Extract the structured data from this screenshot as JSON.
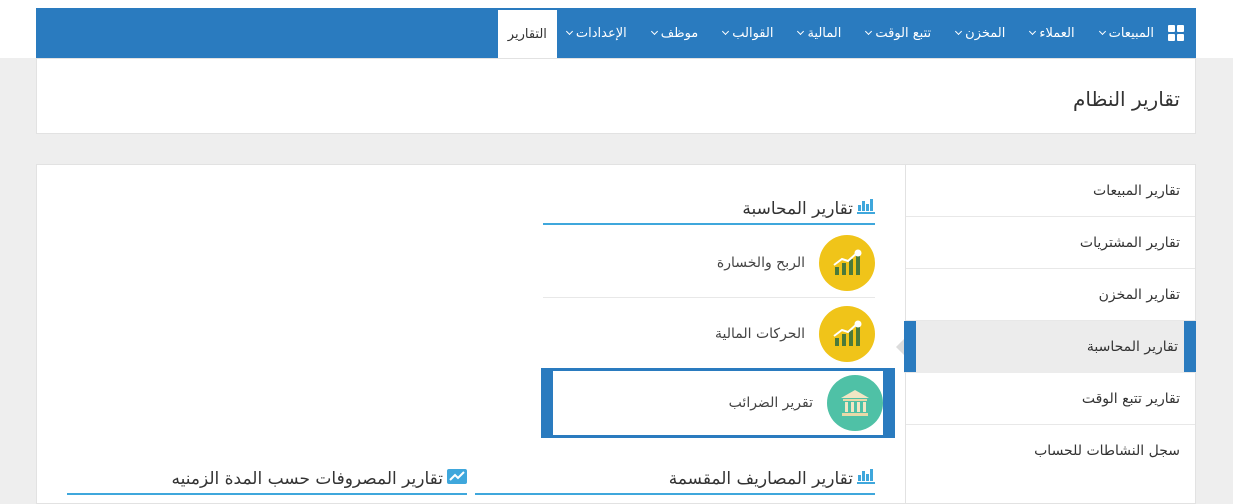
{
  "nav": {
    "items": [
      {
        "label": "المبيعات",
        "has_menu": true
      },
      {
        "label": "العملاء",
        "has_menu": true
      },
      {
        "label": "المخزن",
        "has_menu": true
      },
      {
        "label": "تتبع الوقت",
        "has_menu": true
      },
      {
        "label": "المالية",
        "has_menu": true
      },
      {
        "label": "القوالب",
        "has_menu": true
      },
      {
        "label": "موظف",
        "has_menu": true
      },
      {
        "label": "الإعدادات",
        "has_menu": true
      }
    ],
    "active_label": "التقارير"
  },
  "page": {
    "title": "تقارير النظام"
  },
  "sidebar": {
    "items": [
      {
        "label": "تقارير المبيعات"
      },
      {
        "label": "تقارير المشتريات"
      },
      {
        "label": "تقارير المخزن"
      },
      {
        "label": "تقارير المحاسبة"
      },
      {
        "label": "تقارير تتبع الوقت"
      },
      {
        "label": "سجل النشاطات للحساب"
      }
    ],
    "active_index": 3
  },
  "accounting": {
    "title": "تقارير المحاسبة",
    "reports": [
      {
        "label": "الربح والخسارة"
      },
      {
        "label": "الحركات المالية"
      },
      {
        "label": "تقرير الضرائب"
      }
    ]
  },
  "sections_bottom": {
    "divided_expenses": "تقارير المصاريف المقسمة",
    "expenses_period": "تقارير المصروفات حسب المدة الزمنيه"
  },
  "colors": {
    "nav_bg": "#2a7bbf",
    "accent_underline": "#3fa7dc",
    "gold_circle": "#f0c419",
    "teal_circle": "#4fc1a6"
  }
}
